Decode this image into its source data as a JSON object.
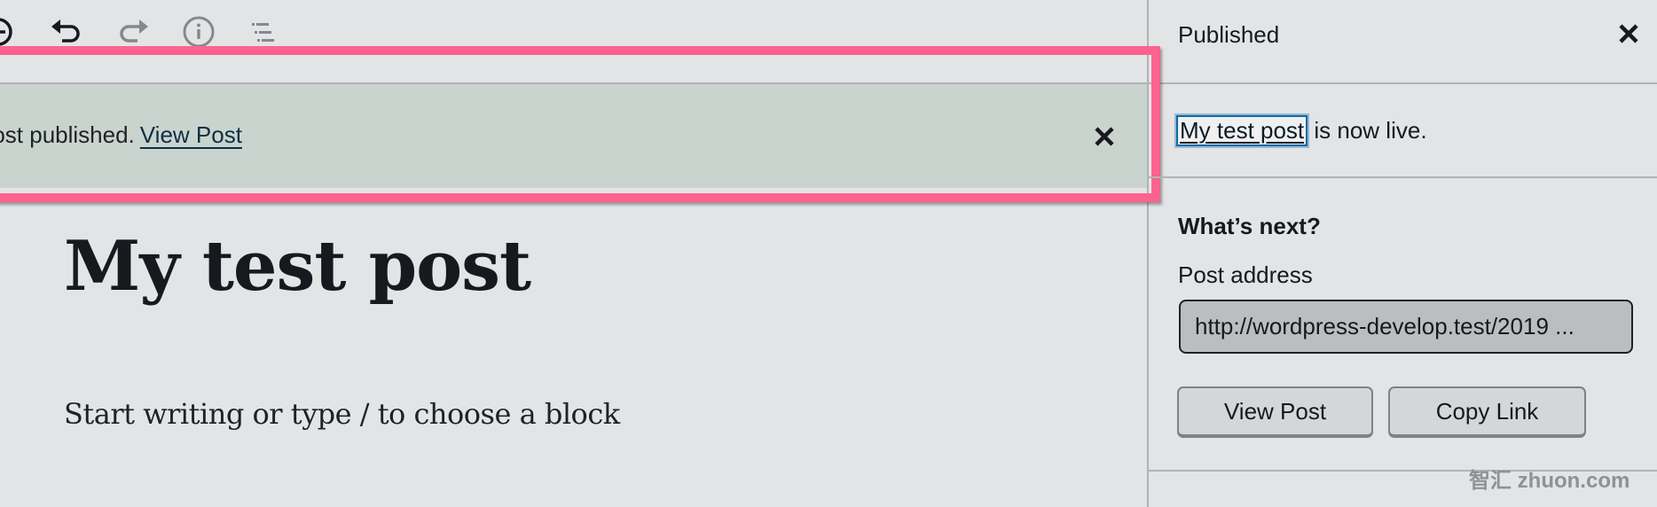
{
  "toolbar": {
    "icons": [
      "add-block-icon",
      "undo-icon",
      "redo-icon",
      "info-icon",
      "list-view-icon"
    ]
  },
  "notice": {
    "text": "Post published.",
    "link_label": "View Post",
    "close_icon": "close-icon",
    "background": "#cad4ce"
  },
  "highlight_color": "#fe628f",
  "editor": {
    "title": "My test post",
    "placeholder": "Start writing or type / to choose a block"
  },
  "panel": {
    "title": "Published",
    "close_icon": "close-icon",
    "post_link": "My test post",
    "live_suffix": " is now live.",
    "whats_next": "What’s next?",
    "address_label": "Post address",
    "address_value": "http://wordpress-develop.test/2019 ...",
    "view_post_button": "View Post",
    "copy_link_button": "Copy Link"
  },
  "watermark": "智汇 zhuon.com"
}
